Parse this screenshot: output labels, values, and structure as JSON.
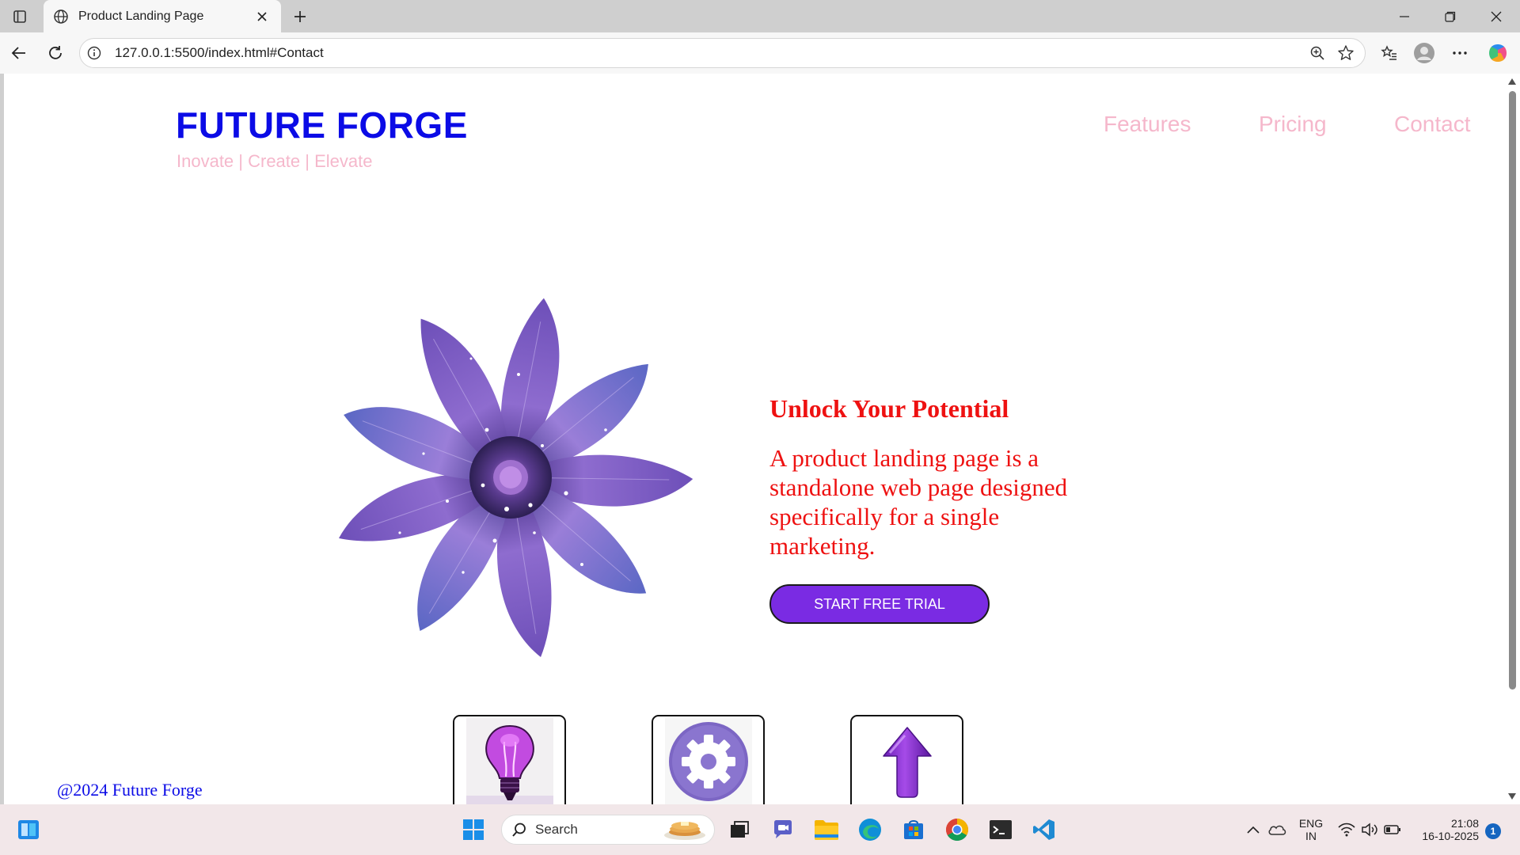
{
  "browser": {
    "tab_title": "Product Landing Page",
    "url": "127.0.0.1:5500/index.html#Contact"
  },
  "page": {
    "brand": "FUTURE FORGE",
    "tagline": "Inovate | Create | Elevate",
    "nav": [
      "Features",
      "Pricing",
      "Contact"
    ],
    "hero_title": "Unlock Your Potential",
    "hero_text": "A product landing page is a standalone web page designed specifically for a single marketing.",
    "cta_label": "START FREE TRIAL",
    "footer": "@2024 Future Forge",
    "feature_icons": [
      "lightbulb-icon",
      "gear-icon",
      "arrow-up-icon"
    ]
  },
  "taskbar": {
    "search_placeholder": "Search",
    "lang_line1": "ENG",
    "lang_line2": "IN",
    "time": "21:08",
    "date": "16-10-2025",
    "notification_count": "1"
  },
  "colors": {
    "brand": "#0b0be6",
    "tagline": "#f5b7cb",
    "hero_text": "#ee1111",
    "cta": "#7a2be3"
  }
}
